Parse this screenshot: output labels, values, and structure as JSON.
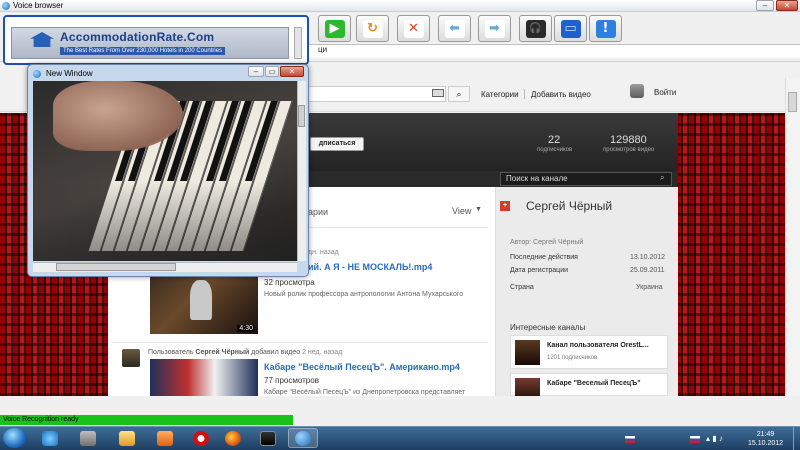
{
  "window": {
    "title": "Voice browser",
    "minimize_glyph": "–",
    "close_glyph": "✕"
  },
  "toolbar": {
    "buttons": [
      {
        "name": "go-button",
        "icon": "play-arrow-icon",
        "glyph": "▶",
        "color": "#2fb82f"
      },
      {
        "name": "refresh-button",
        "icon": "refresh-icon",
        "glyph": "↻",
        "color": "#f08a10"
      },
      {
        "name": "stop-button",
        "icon": "close-icon",
        "glyph": "✕",
        "color": "#e0401e"
      },
      {
        "name": "back-button",
        "icon": "arrow-left-icon",
        "glyph": "⬅",
        "color": "#6aa6d8"
      },
      {
        "name": "forward-button",
        "icon": "arrow-right-icon",
        "glyph": "➡",
        "color": "#6aa6d8"
      },
      {
        "name": "voice-button",
        "icon": "headset-icon",
        "glyph": "🎧",
        "color": "#2a2a2a"
      },
      {
        "name": "display-button",
        "icon": "monitor-icon",
        "glyph": "▭",
        "color": "#1f5fd0"
      },
      {
        "name": "info-button",
        "icon": "info-icon",
        "glyph": "!",
        "color": "#2f7fe0"
      }
    ],
    "address_value": "ци"
  },
  "banner": {
    "name": "AccommodationRate.Com",
    "tagline": "The Best Rates From Over 230,000 Hotels in 200 Countries"
  },
  "popup": {
    "title": "New Window"
  },
  "youtube": {
    "nav_categories": "Категории",
    "nav_add_video": "Добавить видео",
    "login": "Войти",
    "subscribe_fragment": "дписаться",
    "subscribers_count": "22",
    "subscribers_label": "подписчиков",
    "views_count": "129880",
    "views_label": "просмотров видео",
    "channel_search_placeholder": "Поиск на канале",
    "feed": {
      "tab_fragment": "арии",
      "view_label": "View",
      "item1_ago_fragment": "дн. назад",
      "item1_title_fragment": "ий. А Я - НЕ МОСКАЛЬ!.mp4",
      "item1_views": "32 просмотра",
      "item1_desc": "Новый ролик профессора антропологии Антона Мухарського",
      "item1_duration": "4:30",
      "item2_prefix": "Пользователь",
      "item2_user": "Сергей Чёрный",
      "item2_action": "добавил видео",
      "item2_ago": "2 нед. назад",
      "item2_title": "Кабаре \"Весёлый ПесецЪ\". Американо.mp4",
      "item2_views": "77 просмотров",
      "item2_desc": "Кабаре \"Весёлый ПесецЪ\" из Днепропетровска представляет"
    },
    "side": {
      "name": "Сергей Чёрный",
      "author": "Автор: Сергей Чёрный",
      "last_activity_label": "Последние действия",
      "last_activity_value": "13.10.2012",
      "reg_label": "Дата регистрации",
      "reg_value": "25.09.2011",
      "country_label": "Страна",
      "country_value": "Украина",
      "interesting": "Интересные каналы",
      "ch1_title": "Канал пользователя OrestL...",
      "ch1_subs": "1201 подписчиков",
      "ch2_title": "Кабаре \"Веселый ПесецЪ\""
    }
  },
  "status": {
    "text": "Voice Recognition ready"
  },
  "taskbar": {
    "time": "21:49",
    "date": "15.10.2012"
  }
}
